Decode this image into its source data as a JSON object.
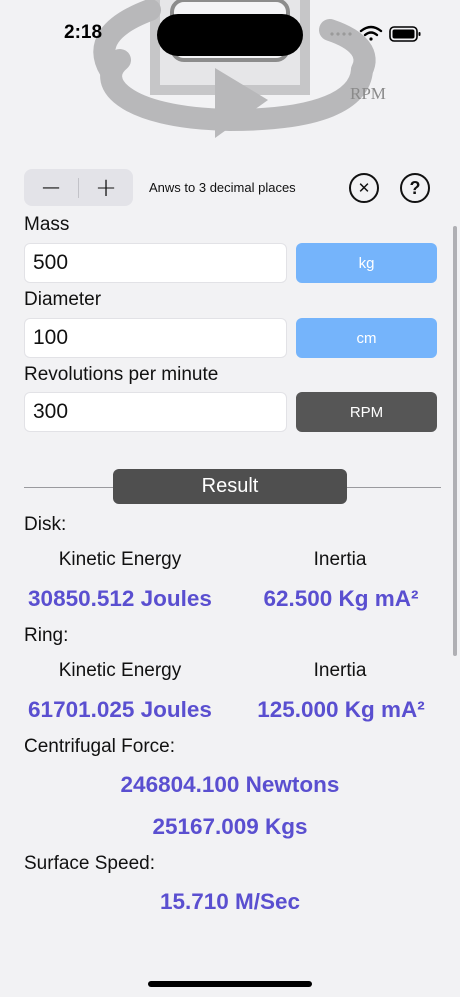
{
  "status": {
    "time": "2:18",
    "icons": [
      "signal-icon",
      "wifi-icon",
      "battery-icon"
    ]
  },
  "header": {
    "art_label": "RPM"
  },
  "controls": {
    "minus": "−",
    "plus": "+",
    "decimal_text": "Anws to 3 decimal places",
    "clear_icon": "✕",
    "help_icon": "?"
  },
  "inputs": {
    "mass": {
      "label": "Mass",
      "value": "500",
      "unit": "kg"
    },
    "diameter": {
      "label": "Diameter",
      "value": "100",
      "unit": "cm"
    },
    "rpm": {
      "label": "Revolutions per minute",
      "value": "300",
      "unit": "RPM"
    }
  },
  "result_title": "Result",
  "disk": {
    "label": "Disk:",
    "ke_head": "Kinetic Energy",
    "inertia_head": "Inertia",
    "ke_value": "30850.512 Joules",
    "inertia_value": "62.500 Kg mA²"
  },
  "ring": {
    "label": "Ring:",
    "ke_head": "Kinetic Energy",
    "inertia_head": "Inertia",
    "ke_value": "61701.025 Joules",
    "inertia_value": "125.000 Kg mA²"
  },
  "centrifugal": {
    "label": "Centrifugal Force:",
    "newtons": "246804.100 Newtons",
    "kgs": "25167.009 Kgs"
  },
  "surface": {
    "label": "Surface Speed:",
    "value": "15.710 M/Sec"
  },
  "colors": {
    "accent_value": "#5a4fd0",
    "unit_blue": "#75b4fb",
    "unit_dark": "#565656"
  }
}
